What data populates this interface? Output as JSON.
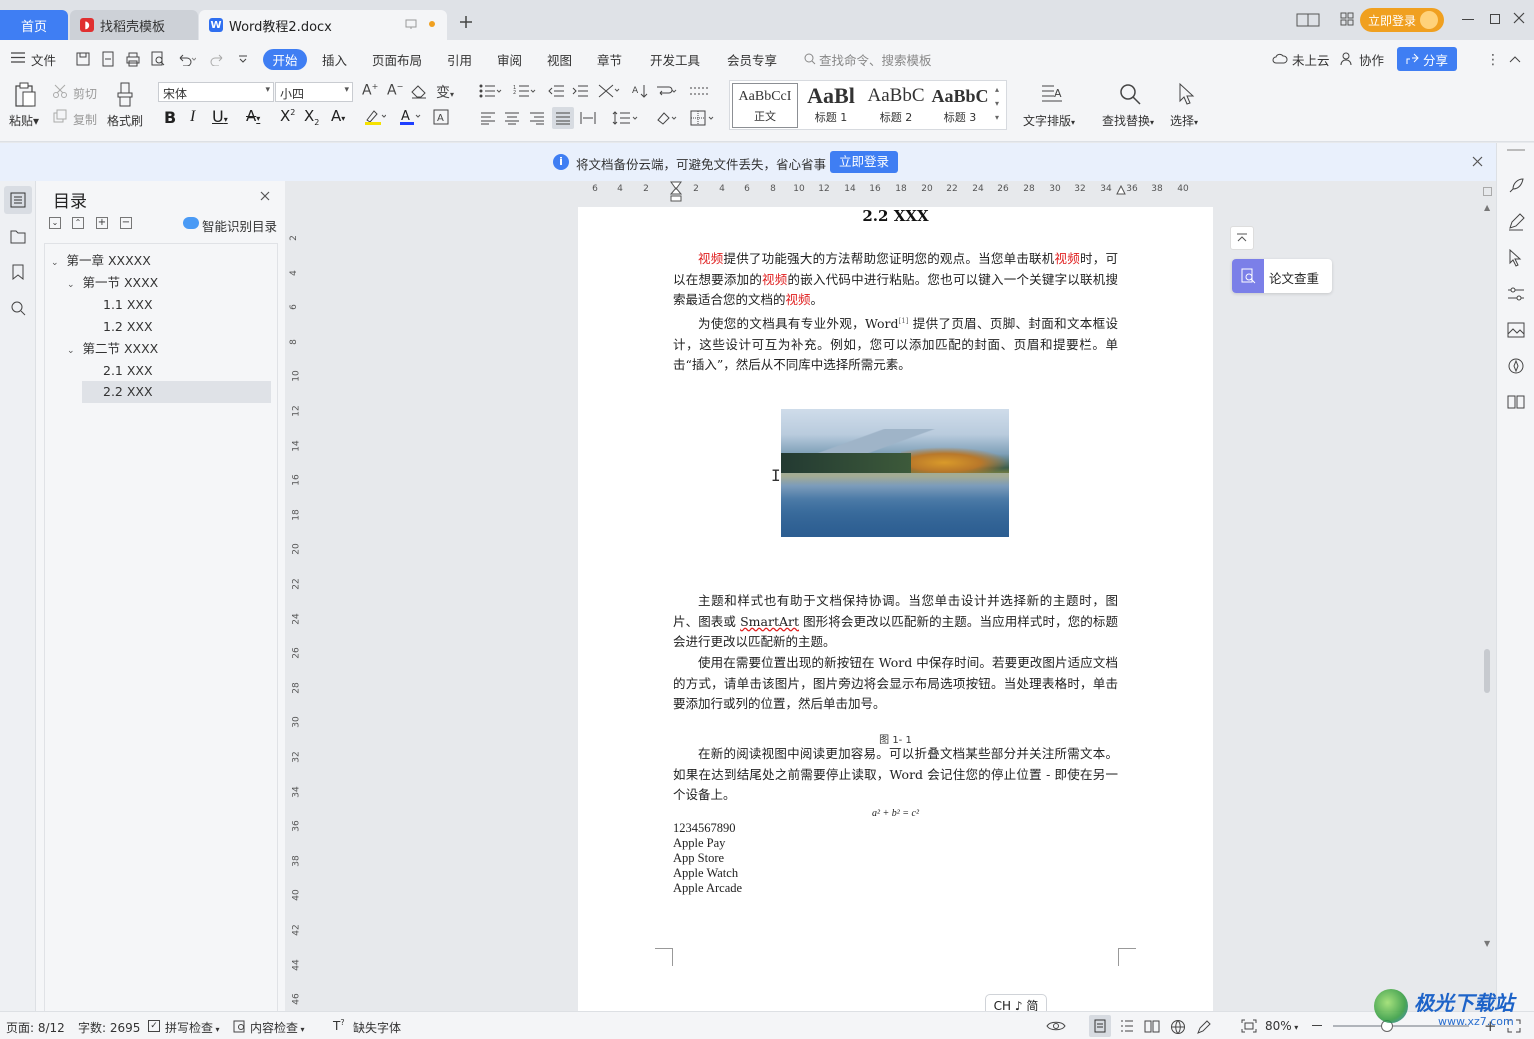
{
  "tabs": {
    "home": "首页",
    "template": "找稻壳模板",
    "document": "Word教程2.docx"
  },
  "titlebar": {
    "login": "立即登录"
  },
  "menu": {
    "file": "文件",
    "items": [
      "开始",
      "插入",
      "页面布局",
      "引用",
      "审阅",
      "视图",
      "章节",
      "开发工具",
      "会员专享"
    ],
    "search_placeholder": "查找命令、搜索模板",
    "cloud": "未上云",
    "collab": "协作",
    "share": "分享"
  },
  "ribbon": {
    "paste": "粘贴",
    "cut": "剪切",
    "copy": "复制",
    "format_painter": "格式刷",
    "font_name": "宋体",
    "font_size": "小四",
    "styles": [
      {
        "preview": "AaBbCcI",
        "label": "正文"
      },
      {
        "preview": "AaBl",
        "label": "标题 1"
      },
      {
        "preview": "AaBbC",
        "label": "标题 2"
      },
      {
        "preview": "AaBbC",
        "label": "标题 3"
      }
    ],
    "text_layout": "文字排版",
    "find_replace": "查找替换",
    "select": "选择"
  },
  "notice": {
    "text": "将文档备份云端，可避免文件丢失，省心省事",
    "button": "立即登录"
  },
  "toc": {
    "title": "目录",
    "smart": "智能识别目录",
    "items": [
      {
        "label": "第一章  XXXXX",
        "level": 1
      },
      {
        "label": "第一节  XXXX",
        "level": 2
      },
      {
        "label": "1.1 XXX",
        "level": 3
      },
      {
        "label": "1.2 XXX",
        "level": 3
      },
      {
        "label": "第二节  XXXX",
        "level": 2
      },
      {
        "label": "2.1 XXX",
        "level": 3
      },
      {
        "label": "2.2 XXX",
        "level": 3,
        "selected": true
      }
    ]
  },
  "ruler": {
    "h_ticks": [
      "6",
      "4",
      "2",
      "2",
      "4",
      "6",
      "8",
      "10",
      "12",
      "14",
      "16",
      "18",
      "20",
      "22",
      "24",
      "26",
      "28",
      "30",
      "32",
      "34",
      "36",
      "38",
      "40"
    ],
    "v_ticks": [
      "2",
      "4",
      "6",
      "8",
      "10",
      "12",
      "14",
      "16",
      "18",
      "20",
      "22",
      "24",
      "26",
      "28",
      "30",
      "32",
      "34",
      "36",
      "38",
      "40",
      "42",
      "44",
      "46"
    ]
  },
  "document": {
    "heading": "2.2 XXX",
    "p1": {
      "w1": "视频",
      "t1": "提供了功能强大的方法帮助您证明您的观点。当您单击联机",
      "w2": "视频",
      "t2": "时，可以在想要添加的",
      "w3": "视频",
      "t3": "的嵌入代码中进行粘贴。您也可以键入一个关键字以联机搜索最适合您的文档的",
      "w4": "视频",
      "t4": "。"
    },
    "p2_a": "为使您的文档具有专业外观，Word",
    "p2_sup": "[1]",
    "p2_b": " 提供了页眉、页脚、封面和文本框设计，这些设计可互为补充。例如，您可以添加匹配的封面、页眉和提要栏。单击“插入”，然后从不同库中选择所需元素。",
    "p3_a": "主题和样式也有助于文档保持协调。当您单击设计并选择新的主题时，图片、图表或 ",
    "p3_smart": "SmartArt",
    "p3_b": " 图形将会更改以匹配新的主题。当应用样式时，您的标题会进行更改以匹配新的主题。",
    "p4": "使用在需要位置出现的新按钮在 Word 中保存时间。若要更改图片适应文档的方式，请单击该图片，图片旁边将会显示布局选项按钮。当处理表格时，单击要添加行或列的位置，然后单击加号。",
    "caption": "图 1- 1",
    "p5": "在新的阅读视图中阅读更加容易。可以折叠文档某些部分并关注所需文本。如果在达到结尾处之前需要停止读取，Word 会记住您的停止位置 - 即使在另一个设备上。",
    "equation": "a² + b² = c²",
    "lines": [
      "1234567890",
      "Apple Pay",
      "App Store",
      "Apple Watch",
      "Apple Arcade"
    ]
  },
  "floating": {
    "paper_check": "论文查重",
    "ime": "CH ♪ 简"
  },
  "status": {
    "page": "页面: 8/12",
    "words": "字数: 2695",
    "spell": "拼写检查",
    "content": "内容检查",
    "missing_font": "缺失字体",
    "zoom": "80%"
  },
  "watermark": {
    "brand": "极光下载站",
    "url": "www.xz7.com"
  },
  "colors": {
    "accent": "#3f7ef3",
    "login_orange": "#f0a020",
    "red_text": "#e02020",
    "paper_check_icon": "#7b7fe8"
  }
}
